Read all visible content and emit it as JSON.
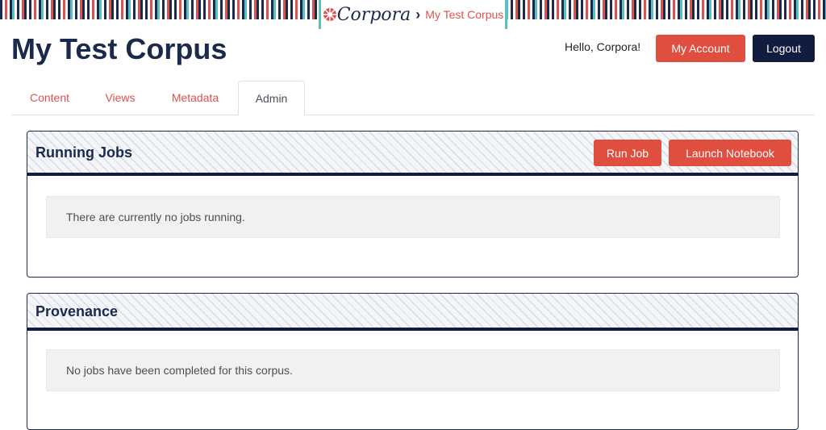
{
  "brand": {
    "logo_text": "Corpora",
    "separator": "›",
    "corpus_link": "My Test Corpus"
  },
  "header": {
    "title": "My Test Corpus",
    "greeting": "Hello, Corpora!",
    "my_account_label": "My Account",
    "logout_label": "Logout"
  },
  "tabs": [
    {
      "label": "Content",
      "active": false
    },
    {
      "label": "Views",
      "active": false
    },
    {
      "label": "Metadata",
      "active": false
    },
    {
      "label": "Admin",
      "active": true
    }
  ],
  "running_jobs": {
    "title": "Running Jobs",
    "run_job_label": "Run Job",
    "launch_notebook_label": "Launch Notebook",
    "empty_message": "There are currently no jobs running."
  },
  "provenance": {
    "title": "Provenance",
    "empty_message": "No jobs have been completed for this corpus."
  },
  "colors": {
    "accent_red": "#e04e3f",
    "navy": "#111c3e",
    "teal": "#5bc0be"
  }
}
